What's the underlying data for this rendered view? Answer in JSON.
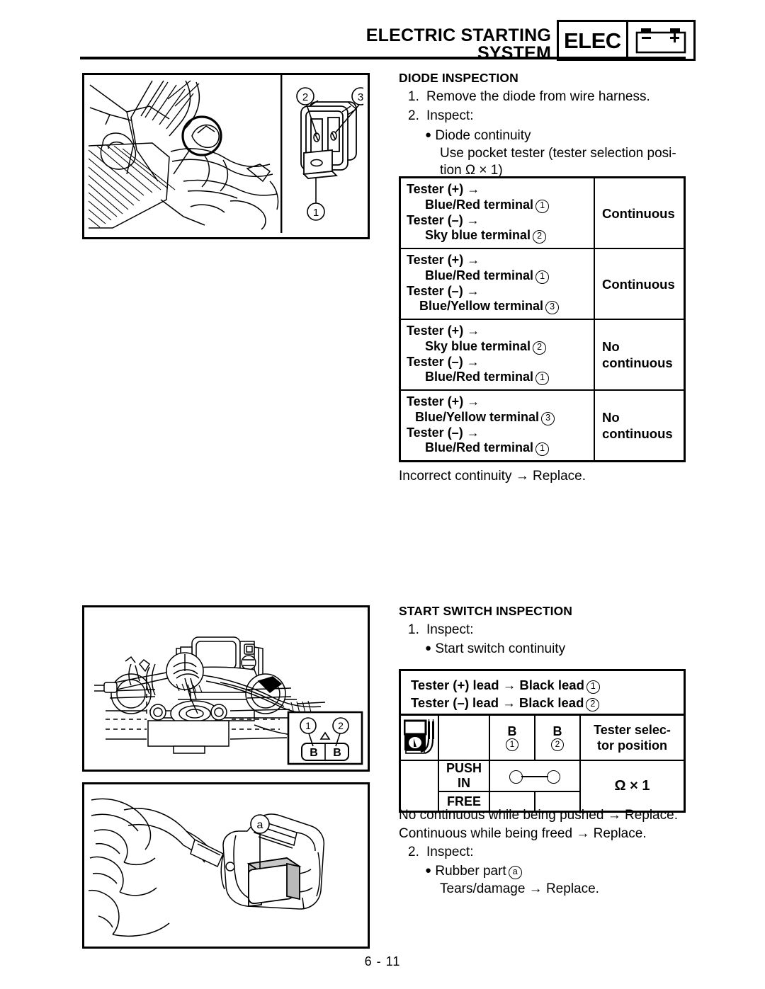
{
  "header": {
    "title": "ELECTRIC STARTING SYSTEM",
    "badge_label": "ELEC",
    "battery_icon": "battery-icon",
    "battery_minus": "–",
    "battery_plus": "+"
  },
  "diode": {
    "heading": "DIODE INSPECTION",
    "steps": [
      {
        "num": "1.",
        "text": "Remove the diode from wire harness."
      },
      {
        "num": "2.",
        "text": "Inspect:"
      }
    ],
    "bullet": "Diode continuity",
    "note_line1": "Use pocket tester (tester selection posi-",
    "note_line2": "tion Ω × 1)",
    "table": [
      {
        "lines": [
          {
            "text": "Tester (+) →",
            "indent": 0,
            "circle": ""
          },
          {
            "text": "Blue/Red terminal",
            "indent": 1,
            "circle": "1"
          },
          {
            "text": "Tester (–) →",
            "indent": 0,
            "circle": ""
          },
          {
            "text": "Sky blue terminal",
            "indent": 1,
            "circle": "2"
          }
        ],
        "result": "Continuous"
      },
      {
        "lines": [
          {
            "text": "Tester (+) →",
            "indent": 0,
            "circle": ""
          },
          {
            "text": "Blue/Red terminal",
            "indent": 1,
            "circle": "1"
          },
          {
            "text": "Tester (–) →",
            "indent": 0,
            "circle": ""
          },
          {
            "text": "Blue/Yellow terminal",
            "indent": 2,
            "circle": "3"
          }
        ],
        "result": "Continuous"
      },
      {
        "lines": [
          {
            "text": "Tester (+) →",
            "indent": 0,
            "circle": ""
          },
          {
            "text": "Sky blue terminal",
            "indent": 1,
            "circle": "2"
          },
          {
            "text": "Tester (–) →",
            "indent": 0,
            "circle": ""
          },
          {
            "text": "Blue/Red terminal",
            "indent": 1,
            "circle": "1"
          }
        ],
        "result": "No\ncontinuous"
      },
      {
        "lines": [
          {
            "text": "Tester (+) →",
            "indent": 0,
            "circle": ""
          },
          {
            "text": "Blue/Yellow terminal",
            "indent": 3,
            "circle": "3"
          },
          {
            "text": "Tester (–) →",
            "indent": 0,
            "circle": ""
          },
          {
            "text": "Blue/Red terminal",
            "indent": 1,
            "circle": "1"
          }
        ],
        "result": "No\ncontinuous"
      }
    ],
    "after_table": "Incorrect continuity → Replace."
  },
  "start_switch": {
    "heading": "START SWITCH INSPECTION",
    "step1_num": "1.",
    "step1_text": "Inspect:",
    "bullet1": "Start switch continuity",
    "lead_line1_a": "Tester (+) lead → Black lead",
    "lead_line1_circle": "1",
    "lead_line2_a": "Tester (–) lead → Black lead",
    "lead_line2_circle": "2",
    "table": {
      "tester_icon": "pocket-tester-icon",
      "terminal_headers": [
        {
          "label": "B",
          "circle": "1"
        },
        {
          "label": "B",
          "circle": "2"
        }
      ],
      "selector_header_line1": "Tester selec-",
      "selector_header_line2": "tor position",
      "rows": [
        {
          "state": "PUSH IN",
          "connected": true
        },
        {
          "state": "FREE",
          "connected": false
        }
      ],
      "selector_value": "Ω × 1"
    },
    "result_line1": "No continuous while being pushed → Replace.",
    "result_line2": "Continuous while being freed → Replace.",
    "step2_num": "2.",
    "step2_text": "Inspect:",
    "bullet2": "Rubber part",
    "bullet2_circle": "a",
    "bullet2_note": "Tears/damage → Replace."
  },
  "figures": {
    "diode_photo": {
      "name": "diode-location-illustration",
      "callouts": [
        "1",
        "2",
        "3"
      ]
    },
    "start_switch_photo": {
      "name": "start-switch-wiring-illustration",
      "callouts": [
        "1",
        "2"
      ],
      "coupler_terminals": [
        "B",
        "B"
      ]
    },
    "rubber_part_photo": {
      "name": "start-switch-rubber-part-illustration",
      "callouts": [
        "a"
      ]
    }
  },
  "footer": {
    "page_number": "6 - 11"
  }
}
